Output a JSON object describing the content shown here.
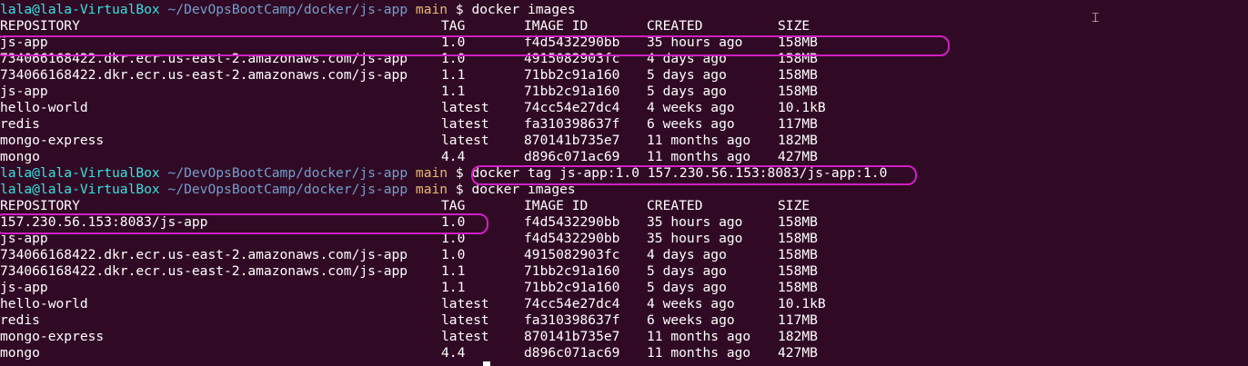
{
  "window": {
    "title": "lala@lala-VirtualBox: ~/DevOpsBootCamp/docker/js-app"
  },
  "prompt": {
    "user": "lala@lala-VirtualBox",
    "path": "~/DevOpsBootCamp/docker/js-app",
    "branch": "main",
    "dollar": "$"
  },
  "commands": {
    "images_1": "docker images",
    "tag": "docker tag js-app:1.0 157.230.56.153:8083/js-app:1.0",
    "images_2": "docker images"
  },
  "table": {
    "headers": [
      "REPOSITORY",
      "TAG",
      "IMAGE ID",
      "CREATED",
      "SIZE"
    ],
    "first_listing": [
      [
        "js-app",
        "1.0",
        "f4d5432290bb",
        "35 hours ago",
        "158MB"
      ],
      [
        "734066168422.dkr.ecr.us-east-2.amazonaws.com/js-app",
        "1.0",
        "4915082903fc",
        "4 days ago",
        "158MB"
      ],
      [
        "734066168422.dkr.ecr.us-east-2.amazonaws.com/js-app",
        "1.1",
        "71bb2c91a160",
        "5 days ago",
        "158MB"
      ],
      [
        "js-app",
        "1.1",
        "71bb2c91a160",
        "5 days ago",
        "158MB"
      ],
      [
        "hello-world",
        "latest",
        "74cc54e27dc4",
        "4 weeks ago",
        "10.1kB"
      ],
      [
        "redis",
        "latest",
        "fa310398637f",
        "6 weeks ago",
        "117MB"
      ],
      [
        "mongo-express",
        "latest",
        "870141b735e7",
        "11 months ago",
        "182MB"
      ],
      [
        "mongo",
        "4.4",
        "d896c071ac69",
        "11 months ago",
        "427MB"
      ]
    ],
    "second_listing": [
      [
        "157.230.56.153:8083/js-app",
        "1.0",
        "f4d5432290bb",
        "35 hours ago",
        "158MB"
      ],
      [
        "js-app",
        "1.0",
        "f4d5432290bb",
        "35 hours ago",
        "158MB"
      ],
      [
        "734066168422.dkr.ecr.us-east-2.amazonaws.com/js-app",
        "1.0",
        "4915082903fc",
        "4 days ago",
        "158MB"
      ],
      [
        "734066168422.dkr.ecr.us-east-2.amazonaws.com/js-app",
        "1.1",
        "71bb2c91a160",
        "5 days ago",
        "158MB"
      ],
      [
        "js-app",
        "1.1",
        "71bb2c91a160",
        "5 days ago",
        "158MB"
      ],
      [
        "hello-world",
        "latest",
        "74cc54e27dc4",
        "4 weeks ago",
        "10.1kB"
      ],
      [
        "redis",
        "latest",
        "fa310398637f",
        "6 weeks ago",
        "117MB"
      ],
      [
        "mongo-express",
        "latest",
        "870141b735e7",
        "11 months ago",
        "182MB"
      ],
      [
        "mongo",
        "4.4",
        "d896c071ac69",
        "11 months ago",
        "427MB"
      ]
    ]
  },
  "colors": {
    "background": "#300a24",
    "foreground": "#ffffff",
    "prompt_user": "#34e2e2",
    "prompt_path": "#729fcf",
    "prompt_branch": "#e9b96e",
    "highlight": "#d11fc4"
  },
  "icons": {
    "text_cursor": "ibeam-icon"
  }
}
